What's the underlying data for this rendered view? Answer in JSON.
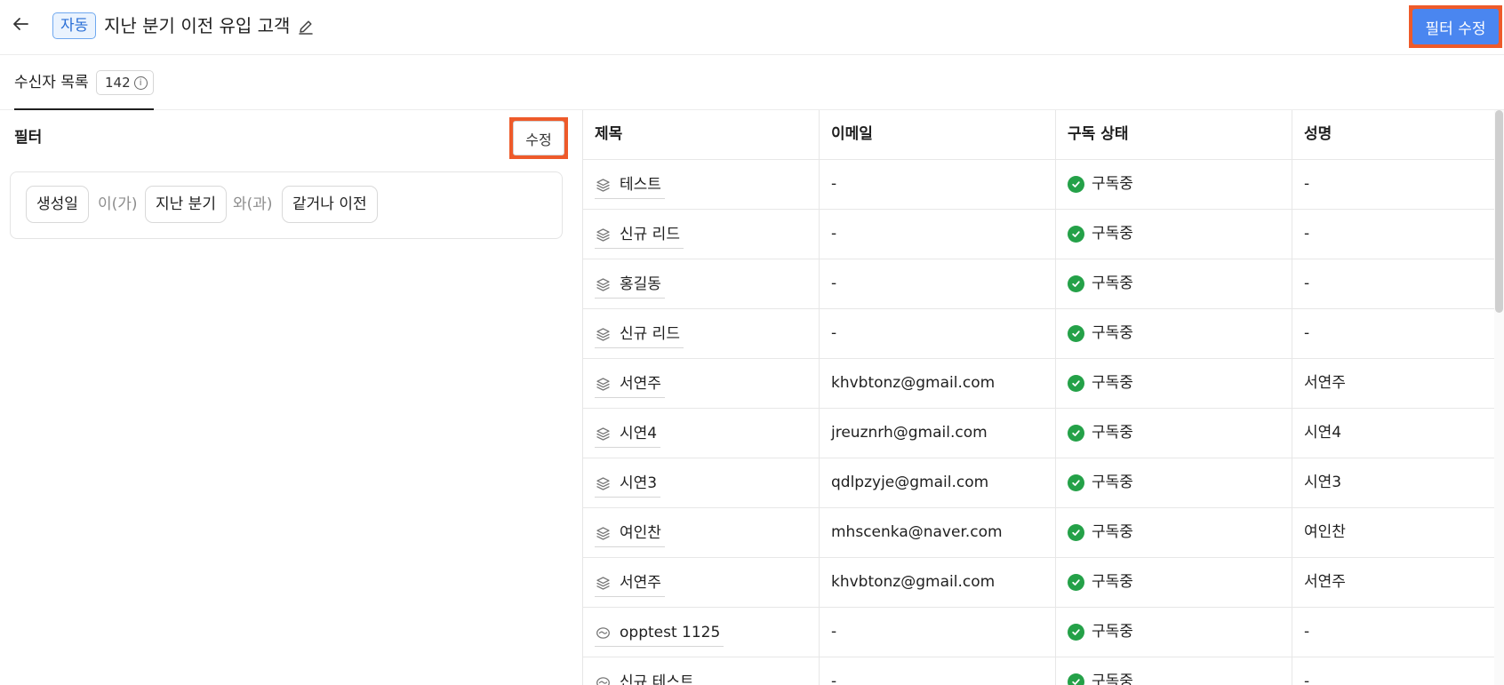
{
  "header": {
    "badge": "자동",
    "title": "지난 분기 이전 유입 고객",
    "primary_button": "필터 수정"
  },
  "tabs": [
    {
      "label": "수신자 목록",
      "count": "142"
    }
  ],
  "filter": {
    "heading": "필터",
    "edit_button": "수정",
    "chips": [
      "생성일",
      "지난 분기",
      "같거나 이전"
    ],
    "conjunctions": [
      "이(가)",
      "와(과)"
    ]
  },
  "table": {
    "columns": [
      "제목",
      "이메일",
      "구독 상태",
      "성명"
    ],
    "rows": [
      {
        "icon": "stack-icon",
        "title": "테스트",
        "email": "-",
        "status": "구독중",
        "name": "-"
      },
      {
        "icon": "stack-icon",
        "title": "신규 리드",
        "email": "-",
        "status": "구독중",
        "name": "-"
      },
      {
        "icon": "stack-icon",
        "title": "홍길동",
        "email": "-",
        "status": "구독중",
        "name": "-"
      },
      {
        "icon": "stack-icon",
        "title": "신규 리드",
        "email": "-",
        "status": "구독중",
        "name": "-"
      },
      {
        "icon": "stack-icon",
        "title": "서연주",
        "email": "khvbtonz@gmail.com",
        "status": "구독중",
        "name": "서연주"
      },
      {
        "icon": "stack-icon",
        "title": "시연4",
        "email": "jreuznrh@gmail.com",
        "status": "구독중",
        "name": "시연4"
      },
      {
        "icon": "stack-icon",
        "title": "시연3",
        "email": "qdlpzyje@gmail.com",
        "status": "구독중",
        "name": "시연3"
      },
      {
        "icon": "stack-icon",
        "title": "여인찬",
        "email": "mhscenka@naver.com",
        "status": "구독중",
        "name": "여인찬"
      },
      {
        "icon": "stack-icon",
        "title": "서연주",
        "email": "khvbtonz@gmail.com",
        "status": "구독중",
        "name": "서연주"
      },
      {
        "icon": "handshake-icon",
        "title": "opptest 1125",
        "email": "-",
        "status": "구독중",
        "name": "-"
      },
      {
        "icon": "handshake-icon",
        "title": "신규 테스트",
        "email": "-",
        "status": "구독중",
        "name": "-"
      }
    ]
  },
  "colors": {
    "accent": "#4a86f0",
    "highlight": "#ee5a2a",
    "status_ok": "#24a148",
    "badge_bg": "#eaf3fe"
  }
}
